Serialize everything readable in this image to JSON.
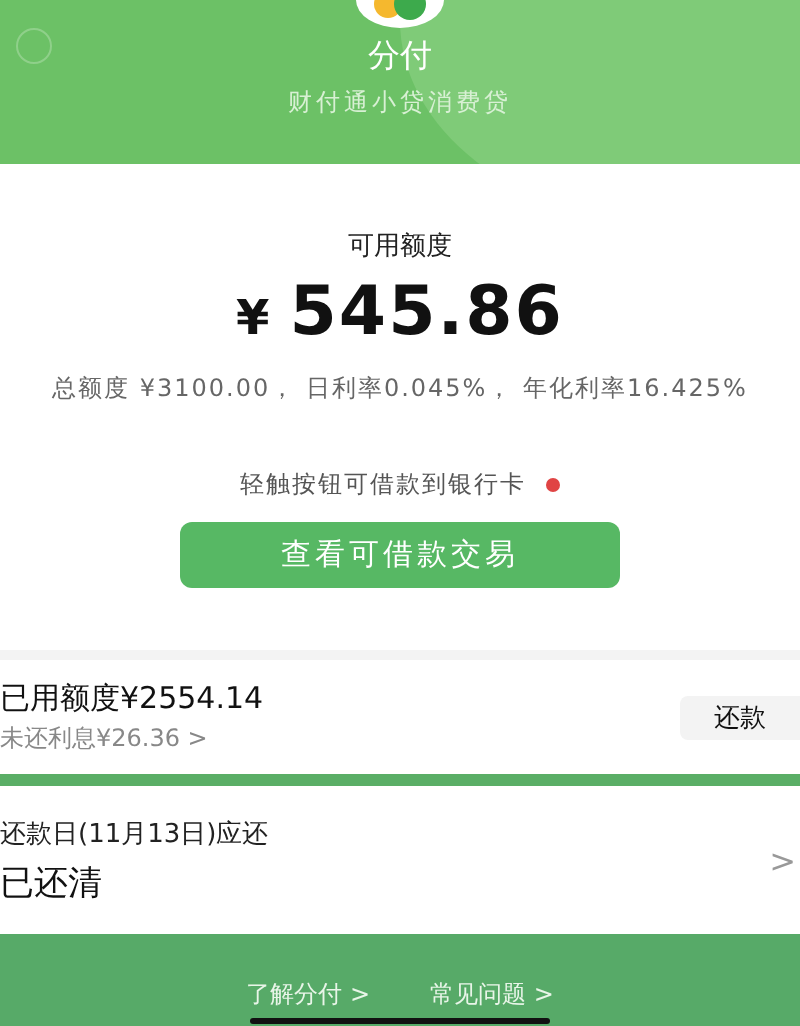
{
  "header": {
    "title": "分付",
    "subtitle": "财付通小贷消费贷"
  },
  "credit": {
    "label": "可用额度",
    "currency": "¥",
    "amount": "545.86",
    "terms": "总额度 ¥3100.00， 日利率0.045%， 年化利率16.425%",
    "hint": "轻触按钮可借款到银行卡",
    "hint_dot": true,
    "button": "查看可借款交易"
  },
  "used": {
    "title": "已用额度¥2554.14",
    "interest": "未还利息¥26.36",
    "interest_arrow": ">",
    "button": "还款"
  },
  "due": {
    "title": "还款日(11月13日)应还",
    "status": "已还清",
    "arrow": ">"
  },
  "footer": {
    "links": [
      {
        "label": "了解分付",
        "arrow": ">"
      },
      {
        "label": "常见问题",
        "arrow": ">"
      }
    ]
  }
}
